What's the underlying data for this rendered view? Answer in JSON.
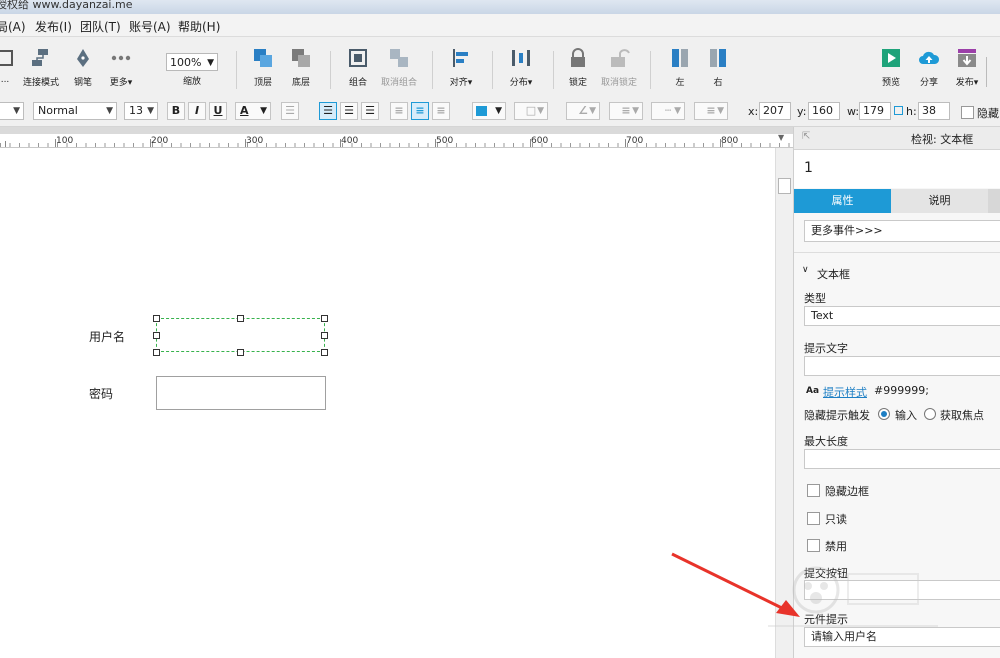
{
  "title": "授权给 www.dayanzai.me",
  "menu": [
    "局(A)",
    "发布(I)",
    "团队(T)",
    "账号(A)",
    "帮助(H)"
  ],
  "toolbar": {
    "items": [
      {
        "label": "..."
      },
      {
        "label": "连接模式"
      },
      {
        "label": "钢笔"
      },
      {
        "label": "更多▾"
      },
      {
        "label": "缩放"
      },
      {
        "label": "顶层"
      },
      {
        "label": "底层"
      },
      {
        "label": "组合"
      },
      {
        "label": "取消组合"
      },
      {
        "label": "对齐▾"
      },
      {
        "label": "分布▾"
      },
      {
        "label": "锁定"
      },
      {
        "label": "取消锁定"
      },
      {
        "label": "左"
      },
      {
        "label": "右"
      },
      {
        "label": "预览"
      },
      {
        "label": "分享"
      },
      {
        "label": "发布▾"
      }
    ],
    "zoom": "100%"
  },
  "format": {
    "style": "Normal",
    "font_size": "13",
    "x_label": "x:",
    "x": "207",
    "y_label": "y:",
    "y": "160",
    "w_label": "w:",
    "w": "179",
    "h_label": "h:",
    "h": "38",
    "hide_label": "隐藏"
  },
  "ruler": [
    "100",
    "200",
    "300",
    "400",
    "500",
    "600",
    "700",
    "800"
  ],
  "canvas": {
    "username_label": "用户名",
    "password_label": "密码"
  },
  "panel": {
    "header": "检视: 文本框",
    "name_value": "1",
    "tab_properties": "属性",
    "tab_notes": "说明",
    "more_events": "更多事件>>>",
    "section_title": "文本框",
    "type_label": "类型",
    "type_value": "Text",
    "hint_label": "提示文字",
    "hint_style_aa": "Aa",
    "hint_style_link": "提示样式",
    "hint_color": "#999999;",
    "hide_trigger_label": "隐藏提示触发",
    "radio_input": "输入",
    "radio_focus": "获取焦点",
    "maxlen_label": "最大长度",
    "cb_hide_border": "隐藏边框",
    "cb_readonly": "只读",
    "cb_disabled": "禁用",
    "submit_label": "提交按钮",
    "tooltip_label": "元件提示",
    "tooltip_value": "请输入用户名"
  },
  "colors": {
    "accent": "#1e9ad6",
    "selection": "#37b24d",
    "arrow": "#e8332a"
  }
}
